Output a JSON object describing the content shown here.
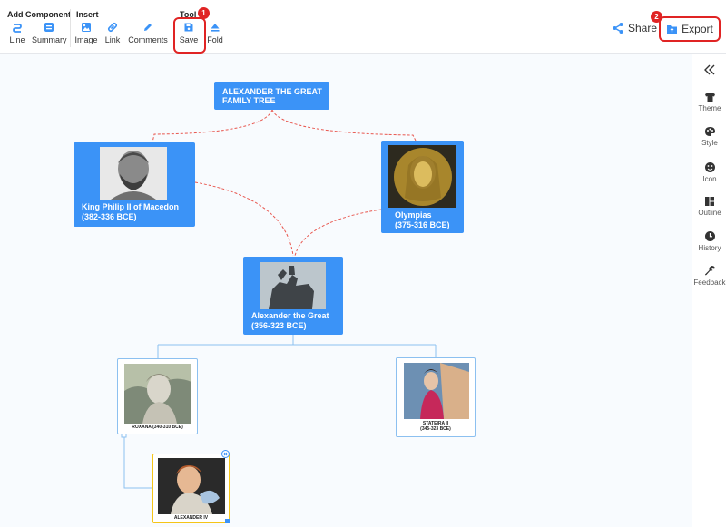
{
  "toolbar": {
    "groups": {
      "add_component": "Add Component",
      "insert": "Insert",
      "tools": "Tool"
    },
    "items": {
      "line": "Line",
      "summary": "Summary",
      "image": "Image",
      "link": "Link",
      "comments": "Comments",
      "save": "Save",
      "fold": "Fold"
    },
    "share": "Share",
    "export": "Export",
    "badges": {
      "save": "1",
      "export": "2"
    }
  },
  "sidebar": {
    "items": [
      "Theme",
      "Style",
      "Icon",
      "Outline",
      "History",
      "Feedback"
    ]
  },
  "tree": {
    "root": {
      "line1": "ALEXANDER THE GREAT",
      "line2": "FAMILY TREE"
    },
    "philip": {
      "line1": "King Philip II of Macedon",
      "line2": "(382-336 BCE)"
    },
    "olympias": {
      "line1": "Olympias",
      "line2": "(375-316 BCE)"
    },
    "alexander": {
      "line1": "Alexander the Great",
      "line2": "(356-323 BCE)"
    },
    "roxana": {
      "caption": "ROXANA (340-310 BCE)"
    },
    "stateira": {
      "line1": "STATEIRA II",
      "line2": "(345-323 BCE)"
    },
    "alexander_iv": {
      "caption": "ALEXANDER IV"
    }
  },
  "colors": {
    "accent": "#3b93f7",
    "highlight": "#e02424",
    "connector_dashed": "#e8574f",
    "connector_solid": "#8cc0f0",
    "selected": "#f5c518"
  }
}
